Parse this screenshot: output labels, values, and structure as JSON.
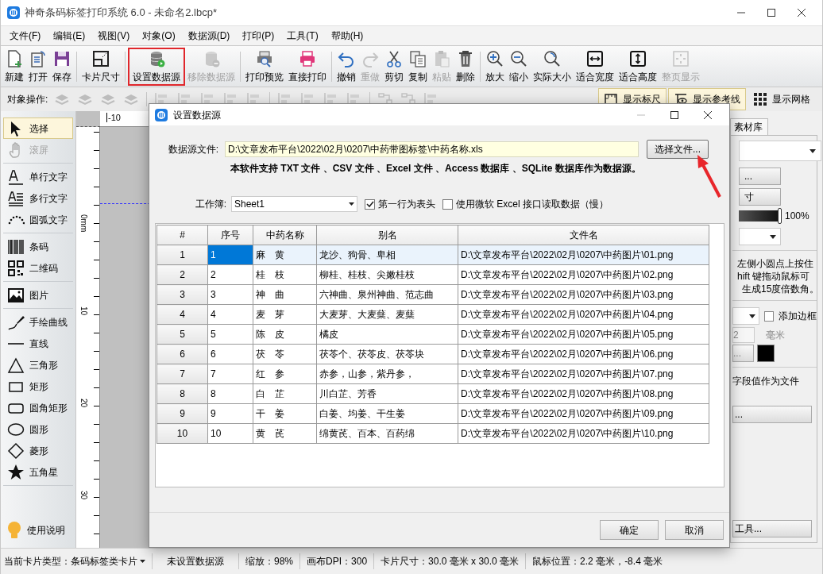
{
  "window": {
    "title": "神奇条码标签打印系统 6.0 - 未命名2.lbcp*"
  },
  "menu": [
    "文件(F)",
    "编辑(E)",
    "视图(V)",
    "对象(O)",
    "数据源(D)",
    "打印(P)",
    "工具(T)",
    "帮助(H)"
  ],
  "toolbar": {
    "groups": [
      [
        {
          "label": "新建",
          "disabled": false,
          "highlighted": false
        },
        {
          "label": "打开",
          "disabled": false,
          "highlighted": false
        },
        {
          "label": "保存",
          "disabled": false,
          "highlighted": false
        }
      ],
      [
        {
          "label": "卡片尺寸",
          "disabled": false,
          "highlighted": false
        }
      ],
      [
        {
          "label": "设置数据源",
          "disabled": false,
          "highlighted": true
        },
        {
          "label": "移除数据源",
          "disabled": true,
          "highlighted": false
        }
      ],
      [
        {
          "label": "打印预览",
          "disabled": false,
          "highlighted": false
        },
        {
          "label": "直接打印",
          "disabled": false,
          "highlighted": false
        }
      ],
      [
        {
          "label": "撤销",
          "disabled": false,
          "highlighted": false
        },
        {
          "label": "重做",
          "disabled": true,
          "highlighted": false
        },
        {
          "label": "剪切",
          "disabled": false,
          "highlighted": false
        },
        {
          "label": "复制",
          "disabled": false,
          "highlighted": false
        },
        {
          "label": "粘贴",
          "disabled": true,
          "highlighted": false
        },
        {
          "label": "删除",
          "disabled": false,
          "highlighted": false
        }
      ],
      [
        {
          "label": "放大",
          "disabled": false,
          "highlighted": false
        },
        {
          "label": "缩小",
          "disabled": false,
          "highlighted": false
        },
        {
          "label": "实际大小",
          "disabled": false,
          "highlighted": false
        },
        {
          "label": "适合宽度",
          "disabled": false,
          "highlighted": false
        },
        {
          "label": "适合高度",
          "disabled": false,
          "highlighted": false
        },
        {
          "label": "整页显示",
          "disabled": true,
          "highlighted": false
        }
      ]
    ]
  },
  "object_ops": {
    "label": "对象操作:"
  },
  "view_toggles": [
    {
      "label": "显示标尺",
      "on": true
    },
    {
      "label": "显示参考线",
      "on": true
    },
    {
      "label": "显示网格",
      "on": false
    }
  ],
  "tools": {
    "groups": [
      [
        {
          "label": "选择",
          "selected": true,
          "disabled": false
        },
        {
          "label": "滚屏",
          "selected": false,
          "disabled": true
        }
      ],
      [
        {
          "label": "单行文字",
          "selected": false,
          "disabled": false
        },
        {
          "label": "多行文字",
          "selected": false,
          "disabled": false
        },
        {
          "label": "圆弧文字",
          "selected": false,
          "disabled": false
        }
      ],
      [
        {
          "label": "条码",
          "selected": false,
          "disabled": false
        },
        {
          "label": "二维码",
          "selected": false,
          "disabled": false
        }
      ],
      [
        {
          "label": "图片",
          "selected": false,
          "disabled": false
        }
      ],
      [
        {
          "label": "手绘曲线",
          "selected": false,
          "disabled": false
        },
        {
          "label": "直线",
          "selected": false,
          "disabled": false
        },
        {
          "label": "三角形",
          "selected": false,
          "disabled": false
        },
        {
          "label": "矩形",
          "selected": false,
          "disabled": false
        },
        {
          "label": "圆角矩形",
          "selected": false,
          "disabled": false
        },
        {
          "label": "圆形",
          "selected": false,
          "disabled": false
        },
        {
          "label": "菱形",
          "selected": false,
          "disabled": false
        },
        {
          "label": "五角星",
          "selected": false,
          "disabled": false
        }
      ]
    ],
    "help": "使用说明"
  },
  "rulers": {
    "horizontal": [
      "-10"
    ],
    "vertical": [
      "0mm",
      "10",
      "20",
      "30"
    ]
  },
  "right_panel": {
    "tab": "素材库",
    "button_1": "...",
    "button_2": "寸",
    "opacity": "100%",
    "opacity_slider": {
      "level": 1
    },
    "hint_lines": [
      "左侧小圆点上按住",
      "hift 键拖动鼠标可",
      "生成15度倍数角。"
    ],
    "border_checkbox": {
      "label": "添加边框",
      "checked": false
    },
    "spin_value": "2",
    "unit": "毫米",
    "button_3": "...",
    "field_note": "字段值作为文件",
    "button_4": "...",
    "button_5": "工具..."
  },
  "dialog": {
    "title": "设置数据源",
    "file_label": "数据源文件:",
    "file_path": "D:\\文章发布平台\\2022\\02月\\0207\\中药带图标签\\中药名称.xls",
    "choose_button": "选择文件...",
    "note": "本软件支持 TXT 文件 、CSV 文件 、Excel 文件 、Access 数据库 、SQLite 数据库作为数据源。",
    "sheet_label": "工作簿:",
    "sheet": "Sheet1",
    "options": [
      {
        "label": "第一行为表头",
        "checked": true
      },
      {
        "label": "使用微软 Excel 接口读取数据（慢）",
        "checked": false
      }
    ],
    "table": {
      "columns": [
        "#",
        "序号",
        "中药名称",
        "别名",
        "文件名"
      ],
      "rows": [
        {
          "cells": [
            "1",
            "1",
            "麻　黄",
            "龙沙、狗骨、卑相",
            "D:\\文章发布平台\\2022\\02月\\0207\\中药图片\\01.png"
          ],
          "selected": true
        },
        {
          "cells": [
            "2",
            "2",
            "桂　枝",
            "柳桂、桂枝、尖嫩桂枝",
            "D:\\文章发布平台\\2022\\02月\\0207\\中药图片\\02.png"
          ],
          "selected": false
        },
        {
          "cells": [
            "3",
            "3",
            "神　曲",
            "六神曲、泉州神曲、范志曲",
            "D:\\文章发布平台\\2022\\02月\\0207\\中药图片\\03.png"
          ],
          "selected": false
        },
        {
          "cells": [
            "4",
            "4",
            "麦　芽",
            "大麦芽、大麦蘖、麦蘖",
            "D:\\文章发布平台\\2022\\02月\\0207\\中药图片\\04.png"
          ],
          "selected": false
        },
        {
          "cells": [
            "5",
            "5",
            "陈　皮",
            "橘皮",
            "D:\\文章发布平台\\2022\\02月\\0207\\中药图片\\05.png"
          ],
          "selected": false
        },
        {
          "cells": [
            "6",
            "6",
            "茯　苓",
            "茯苓个、茯苓皮、茯苓块",
            "D:\\文章发布平台\\2022\\02月\\0207\\中药图片\\06.png"
          ],
          "selected": false
        },
        {
          "cells": [
            "7",
            "7",
            "红　参",
            "赤参，山参，紫丹参，",
            "D:\\文章发布平台\\2022\\02月\\0207\\中药图片\\07.png"
          ],
          "selected": false
        },
        {
          "cells": [
            "8",
            "8",
            "白　芷",
            "川白芷、芳香",
            "D:\\文章发布平台\\2022\\02月\\0207\\中药图片\\08.png"
          ],
          "selected": false
        },
        {
          "cells": [
            "9",
            "9",
            "干　姜",
            "白姜、均姜、干生姜",
            "D:\\文章发布平台\\2022\\02月\\0207\\中药图片\\09.png"
          ],
          "selected": false
        },
        {
          "cells": [
            "10",
            "10",
            "黄　芪",
            "绵黄芪、百本、百药绵",
            "D:\\文章发布平台\\2022\\02月\\0207\\中药图片\\10.png"
          ],
          "selected": false
        }
      ]
    },
    "buttons": [
      "确定",
      "取消"
    ]
  },
  "status_bar": [
    {
      "kind": "dropdown",
      "text": "当前卡片类型：条码标签类卡片"
    },
    {
      "kind": "text",
      "text": "未设置数据源"
    },
    {
      "kind": "text",
      "text": "缩放：98%"
    },
    {
      "kind": "text",
      "text": "画布DPI：300"
    },
    {
      "kind": "text",
      "text": "卡片尺寸：30.0 毫米 x 30.0 毫米"
    },
    {
      "kind": "text",
      "text": "鼠标位置：2.2 毫米，-8.4 毫米"
    }
  ]
}
